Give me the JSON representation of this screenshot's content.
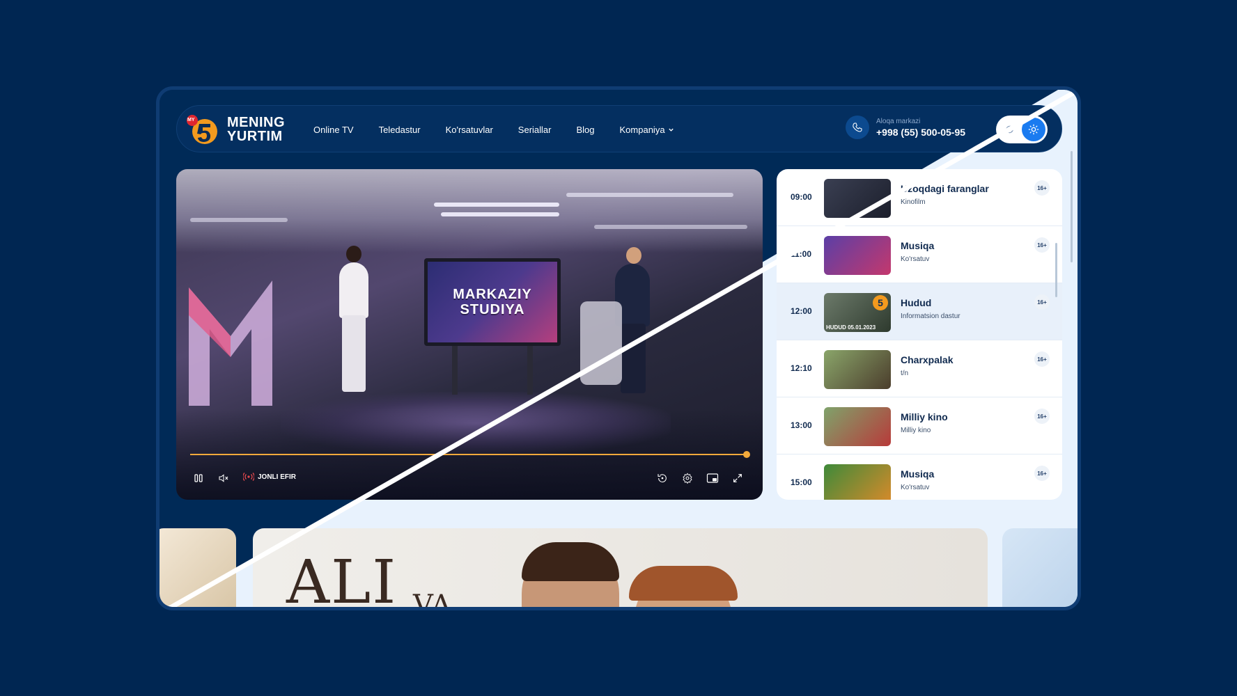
{
  "header": {
    "logo": {
      "badge": "MY",
      "digit": "5",
      "line1": "MENING",
      "line2": "YURTIM"
    },
    "nav": [
      {
        "label": "Online TV"
      },
      {
        "label": "Teledastur"
      },
      {
        "label": "Ko'rsatuvlar"
      },
      {
        "label": "Seriallar"
      },
      {
        "label": "Blog"
      },
      {
        "label": "Kompaniya"
      }
    ],
    "contact": {
      "label": "Aloqa markazi",
      "phone": "+998 (55) 500-05-95"
    },
    "theme": {
      "moon_icon": "moon-icon",
      "sun_icon": "sun-icon",
      "active": "light"
    }
  },
  "player": {
    "screen_text_1": "MARKAZIY",
    "screen_text_2": "STUDIYA",
    "live_label": "JONLI EFIR",
    "progress": 1.0,
    "colors": {
      "accent": "#f2a93b",
      "live": "#e5484d"
    }
  },
  "schedule": [
    {
      "time": "09:00",
      "title": "Uzoqdagi faranglar",
      "subtitle": "Kinofilm",
      "age": "16+"
    },
    {
      "time": "11:00",
      "title": "Musiqa",
      "subtitle": "Ko'rsatuv",
      "age": "16+"
    },
    {
      "time": "12:00",
      "title": "Hudud",
      "subtitle": "Informatsion dastur",
      "age": "16+",
      "thumb_caption": "HUDUD 05.01.2023"
    },
    {
      "time": "12:10",
      "title": "Charxpalak",
      "subtitle": "t/n",
      "age": "16+"
    },
    {
      "time": "13:00",
      "title": "Milliy kino",
      "subtitle": "Milliy kino",
      "age": "16+"
    },
    {
      "time": "15:00",
      "title": "Musiqa",
      "subtitle": "Ko'rsatuv",
      "age": "16+"
    }
  ],
  "banner": {
    "title": "ALI",
    "subtitle": "VA"
  },
  "colors": {
    "page_bg": "#002652",
    "header_bg": "#042f60",
    "light_bg": "#e8f2fd",
    "primary": "#1a7bf0"
  }
}
